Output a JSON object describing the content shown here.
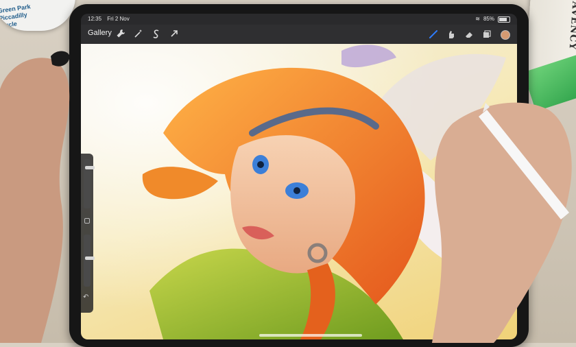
{
  "desk": {
    "mug_text": "Green Park\nPiccadilly\nCircle",
    "book_text": "AVENCY"
  },
  "status_bar": {
    "time": "12:35",
    "date": "Fri 2 Nov",
    "battery": "85%",
    "wifi_icon": "wifi-icon",
    "battery_icon": "battery-icon"
  },
  "toolbar": {
    "gallery_label": "Gallery",
    "left_tools": [
      {
        "name": "actions-wrench-icon",
        "glyph": "🔧"
      },
      {
        "name": "adjustments-wand-icon",
        "glyph": "✦"
      },
      {
        "name": "selection-s-icon",
        "glyph": "S"
      },
      {
        "name": "transform-arrow-icon",
        "glyph": "➚"
      }
    ],
    "right_tools": [
      {
        "name": "brush-icon",
        "glyph": "╱",
        "active": true
      },
      {
        "name": "smudge-icon",
        "glyph": "✋"
      },
      {
        "name": "eraser-icon",
        "glyph": "▰"
      },
      {
        "name": "layers-icon",
        "glyph": "❐"
      }
    ],
    "current_color": "#d59a72",
    "accent_color": "#2f7dff"
  },
  "sidebar": {
    "brush_size_level": 0.15,
    "brush_opacity_level": 0.45
  }
}
